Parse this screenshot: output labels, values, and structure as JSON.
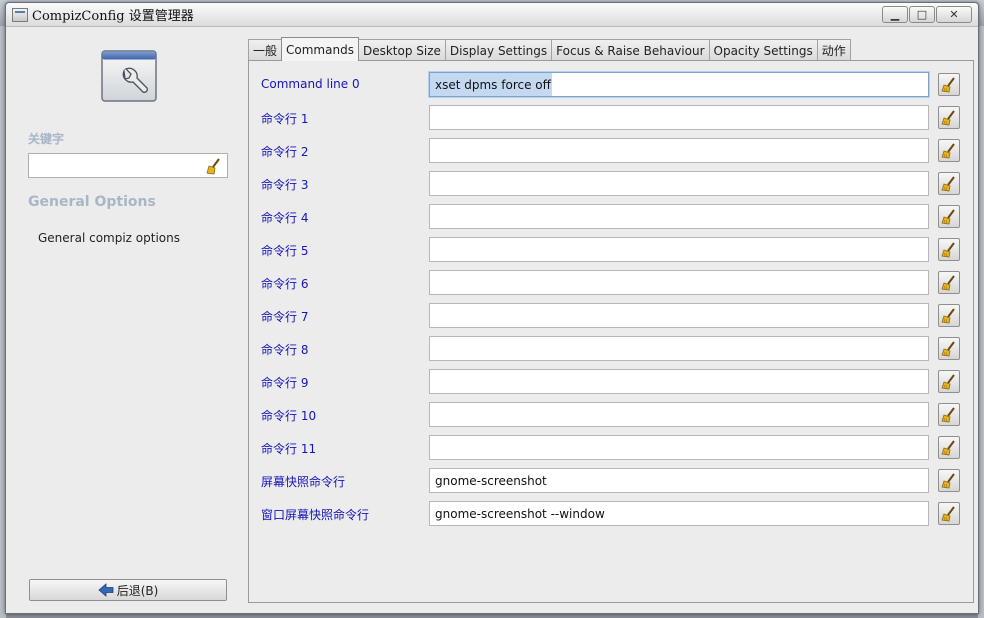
{
  "window": {
    "title": "CompizConfig 设置管理器",
    "minimize_glyph": "▁",
    "maximize_glyph": "□",
    "close_glyph": "✕"
  },
  "sidebar": {
    "keyword_label": "关键字",
    "search_value": "",
    "section_title": "General Options",
    "section_item": "General compiz options",
    "back_button_label": "后退(B)"
  },
  "tabs": [
    {
      "label": "一般",
      "active": false
    },
    {
      "label": "Commands",
      "active": true
    },
    {
      "label": "Desktop Size",
      "active": false
    },
    {
      "label": "Display Settings",
      "active": false
    },
    {
      "label": "Focus & Raise Behaviour",
      "active": false
    },
    {
      "label": "Opacity Settings",
      "active": false
    },
    {
      "label": "动作",
      "active": false
    }
  ],
  "commands": [
    {
      "label": "Command line 0",
      "value": "xset dpms force off",
      "selected": true
    },
    {
      "label": "命令行 1",
      "value": ""
    },
    {
      "label": "命令行 2",
      "value": ""
    },
    {
      "label": "命令行 3",
      "value": ""
    },
    {
      "label": "命令行 4",
      "value": ""
    },
    {
      "label": "命令行 5",
      "value": ""
    },
    {
      "label": "命令行 6",
      "value": ""
    },
    {
      "label": "命令行 7",
      "value": ""
    },
    {
      "label": "命令行 8",
      "value": ""
    },
    {
      "label": "命令行 9",
      "value": ""
    },
    {
      "label": "命令行 10",
      "value": ""
    },
    {
      "label": "命令行 11",
      "value": ""
    },
    {
      "label": "屏幕快照命令行",
      "value": "gnome-screenshot"
    },
    {
      "label": "窗口屏幕快照命令行",
      "value": "gnome-screenshot --window"
    }
  ],
  "colors": {
    "label_blue": "#1515b8",
    "heading_grey": "#a9b6c6",
    "selection": "#c4d9f1"
  }
}
